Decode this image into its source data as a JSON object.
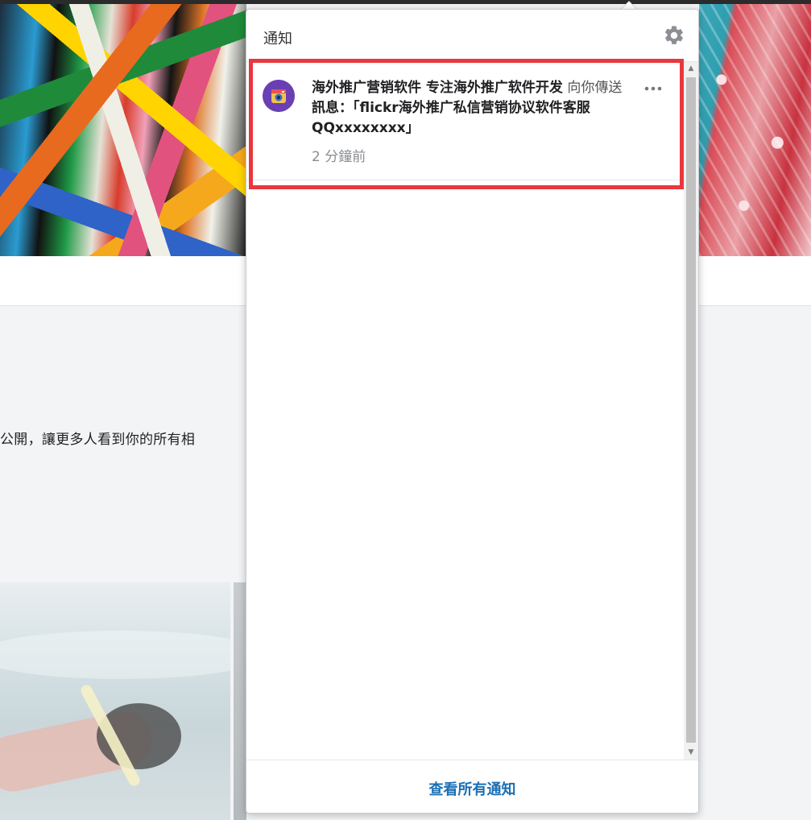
{
  "background": {
    "profile_text": "公開，讓更多人看到你的所有相"
  },
  "popover": {
    "title": "通知",
    "settings_icon": "gear-icon",
    "notifications": [
      {
        "sender": "海外推广营销软件 专注海外推广软件开发",
        "action": "向你傳送",
        "message": "訊息：「flickr海外推广私信营销协议软件客服QQxxxxxxxx」",
        "time": "2 分鐘前",
        "avatar_icon": "camera-avatar-icon",
        "more_icon": "more-dots-icon"
      }
    ],
    "footer_link": "查看所有通知"
  },
  "colors": {
    "highlight_border": "#e8383d",
    "link": "#1b6fb3",
    "avatar_bg": "#6a3fb3"
  }
}
